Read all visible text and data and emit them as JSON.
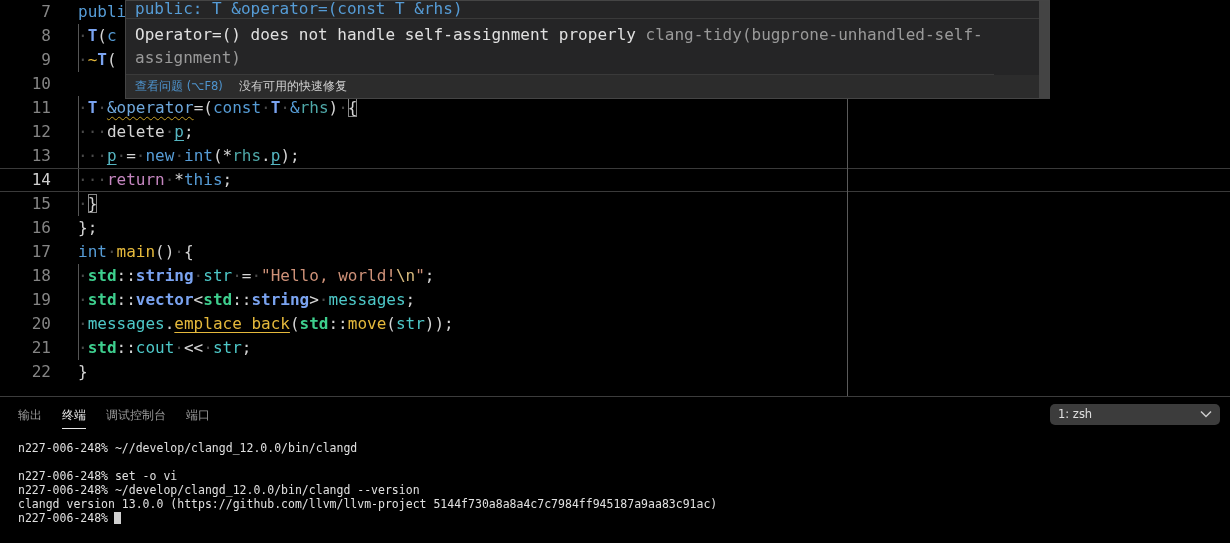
{
  "editor": {
    "lines": [
      {
        "number": "7",
        "current": false,
        "tokens": [
          {
            "kind": "kw",
            "text": "publi"
          }
        ]
      },
      {
        "number": "8",
        "current": false,
        "tokens": [
          {
            "kind": "ws",
            "text": "·"
          },
          {
            "kind": "type",
            "text": "T"
          },
          {
            "kind": "plain",
            "text": "("
          },
          {
            "kind": "kw",
            "text": "c"
          }
        ]
      },
      {
        "number": "9",
        "current": false,
        "tokens": [
          {
            "kind": "ws",
            "text": "·"
          },
          {
            "kind": "fn",
            "text": "~"
          },
          {
            "kind": "type",
            "text": "T"
          },
          {
            "kind": "plain",
            "text": "("
          }
        ]
      },
      {
        "number": "10",
        "current": false
      },
      {
        "number": "11",
        "current": false,
        "tokens": [
          {
            "kind": "ws",
            "text": "·"
          },
          {
            "kind": "type",
            "text": "T"
          },
          {
            "kind": "ws",
            "text": "·"
          },
          {
            "kind": "warn",
            "text": "&operator"
          },
          {
            "kind": "plain",
            "text": "=("
          },
          {
            "kind": "kw",
            "text": "const"
          },
          {
            "kind": "ws",
            "text": "·"
          },
          {
            "kind": "type",
            "text": "T"
          },
          {
            "kind": "ws",
            "text": "·"
          },
          {
            "kind": "kw",
            "text": "&"
          },
          {
            "kind": "param",
            "text": "rhs"
          },
          {
            "kind": "plain",
            "text": ")"
          },
          {
            "kind": "ws",
            "text": "·"
          },
          {
            "kind": "bracket",
            "text": "{"
          }
        ]
      },
      {
        "number": "12",
        "current": false,
        "tokens": [
          {
            "kind": "ws",
            "text": "···"
          },
          {
            "kind": "plain",
            "text": "delete"
          },
          {
            "kind": "ws",
            "text": "·"
          },
          {
            "kind": "field",
            "text": "p"
          },
          {
            "kind": "plain",
            "text": ";"
          }
        ]
      },
      {
        "number": "13",
        "current": false,
        "tokens": [
          {
            "kind": "ws",
            "text": "···"
          },
          {
            "kind": "field",
            "text": "p"
          },
          {
            "kind": "ws",
            "text": "·"
          },
          {
            "kind": "plain",
            "text": "="
          },
          {
            "kind": "ws",
            "text": "·"
          },
          {
            "kind": "kw",
            "text": "new"
          },
          {
            "kind": "ws",
            "text": "·"
          },
          {
            "kind": "kw",
            "text": "int"
          },
          {
            "kind": "plain",
            "text": "(*"
          },
          {
            "kind": "param",
            "text": "rhs"
          },
          {
            "kind": "plain",
            "text": "."
          },
          {
            "kind": "field",
            "text": "p"
          },
          {
            "kind": "plain",
            "text": ");"
          }
        ]
      },
      {
        "number": "14",
        "current": true,
        "tokens": [
          {
            "kind": "ws",
            "text": "···"
          },
          {
            "kind": "control",
            "text": "return"
          },
          {
            "kind": "ws",
            "text": "·"
          },
          {
            "kind": "plain",
            "text": "*"
          },
          {
            "kind": "kw",
            "text": "this"
          },
          {
            "kind": "plain",
            "text": ";"
          }
        ]
      },
      {
        "number": "15",
        "current": false,
        "tokens": [
          {
            "kind": "ws",
            "text": "·"
          },
          {
            "kind": "bracket",
            "text": "}"
          }
        ]
      },
      {
        "number": "16",
        "current": false,
        "tokens": [
          {
            "kind": "plain",
            "text": "};"
          }
        ]
      },
      {
        "number": "17",
        "current": false,
        "tokens": [
          {
            "kind": "kw",
            "text": "int"
          },
          {
            "kind": "ws",
            "text": "·"
          },
          {
            "kind": "fn",
            "text": "main"
          },
          {
            "kind": "plain",
            "text": "()"
          },
          {
            "kind": "ws",
            "text": "·"
          },
          {
            "kind": "plain",
            "text": "{"
          }
        ]
      },
      {
        "number": "18",
        "current": false,
        "tokens": [
          {
            "kind": "ws",
            "text": "·"
          },
          {
            "kind": "ns",
            "text": "std"
          },
          {
            "kind": "plain",
            "text": "::"
          },
          {
            "kind": "type",
            "text": "string"
          },
          {
            "kind": "ws",
            "text": "·"
          },
          {
            "kind": "var",
            "text": "str"
          },
          {
            "kind": "ws",
            "text": "·"
          },
          {
            "kind": "plain",
            "text": "="
          },
          {
            "kind": "ws",
            "text": "·"
          },
          {
            "kind": "string",
            "text": "\"Hello, world!"
          },
          {
            "kind": "escape",
            "text": "\\n"
          },
          {
            "kind": "string",
            "text": "\""
          },
          {
            "kind": "plain",
            "text": ";"
          }
        ]
      },
      {
        "number": "19",
        "current": false,
        "tokens": [
          {
            "kind": "ws",
            "text": "·"
          },
          {
            "kind": "ns",
            "text": "std"
          },
          {
            "kind": "plain",
            "text": "::"
          },
          {
            "kind": "type",
            "text": "vector"
          },
          {
            "kind": "plain",
            "text": "<"
          },
          {
            "kind": "ns",
            "text": "std"
          },
          {
            "kind": "plain",
            "text": "::"
          },
          {
            "kind": "type",
            "text": "string"
          },
          {
            "kind": "plain",
            "text": ">"
          },
          {
            "kind": "ws",
            "text": "·"
          },
          {
            "kind": "var",
            "text": "messages"
          },
          {
            "kind": "plain",
            "text": ";"
          }
        ]
      },
      {
        "number": "20",
        "current": false,
        "tokens": [
          {
            "kind": "ws",
            "text": "·"
          },
          {
            "kind": "var",
            "text": "messages"
          },
          {
            "kind": "plain",
            "text": "."
          },
          {
            "kind": "call",
            "text": "emplace_back"
          },
          {
            "kind": "plain",
            "text": "("
          },
          {
            "kind": "ns",
            "text": "std"
          },
          {
            "kind": "plain",
            "text": "::"
          },
          {
            "kind": "fn",
            "text": "move"
          },
          {
            "kind": "plain",
            "text": "("
          },
          {
            "kind": "var",
            "text": "str"
          },
          {
            "kind": "plain",
            "text": "));"
          }
        ]
      },
      {
        "number": "21",
        "current": false,
        "tokens": [
          {
            "kind": "ws",
            "text": "·"
          },
          {
            "kind": "ns",
            "text": "std"
          },
          {
            "kind": "plain",
            "text": "::"
          },
          {
            "kind": "var",
            "text": "cout"
          },
          {
            "kind": "ws",
            "text": "·"
          },
          {
            "kind": "plain",
            "text": "<<"
          },
          {
            "kind": "ws",
            "text": "·"
          },
          {
            "kind": "var",
            "text": "str"
          },
          {
            "kind": "plain",
            "text": ";"
          }
        ]
      },
      {
        "number": "22",
        "current": false,
        "tokens": [
          {
            "kind": "plain",
            "text": "}"
          }
        ]
      }
    ]
  },
  "hover": {
    "signature": "public: T &operator=(const T &rhs)",
    "message": "Operator=() does not handle self-assignment properly",
    "source": "clang-tidy(bugprone-unhandled-self-assignment)",
    "link": "查看问题 (⌥F8)",
    "note": "没有可用的快速修复"
  },
  "panel": {
    "tabs": [
      {
        "label": "输出",
        "selected": false
      },
      {
        "label": "终端",
        "selected": true
      },
      {
        "label": "调试控制台",
        "selected": false
      },
      {
        "label": "端口",
        "selected": false
      }
    ],
    "terminal_select": "1: zsh",
    "terminal": {
      "blocks": [
        [
          "n227-006-248% ~//develop/clangd_12.0.0/bin/clangd"
        ],
        [
          "n227-006-248% set -o vi",
          "n227-006-248% ~/develop/clangd_12.0.0/bin/clangd --version",
          "clangd version 13.0.0 (https://github.com/llvm/llvm-project 5144f730a8a8a4c7c7984ff945187a9aa83c91ac)",
          "n227-006-248%"
        ]
      ],
      "cursor": true
    }
  }
}
